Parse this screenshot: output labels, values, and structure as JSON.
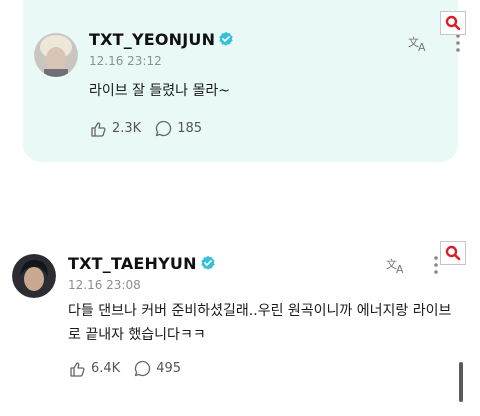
{
  "posts": [
    {
      "username": "TXT_YEONJUN",
      "timestamp": "12.16 23:12",
      "text": "라이브 잘 들렸나 몰라~",
      "likes": "2.3K",
      "comments": "185",
      "avatar_icon": "blond-avatar"
    },
    {
      "username": "TXT_TAEHYUN",
      "timestamp": "12.16 23:08",
      "text": "다들 댄브나 커버 준비하셨길래..우린 원곡이니까 에너지랑 라이브로 끝내자 했습니다ㅋㅋ",
      "likes": "6.4K",
      "comments": "495",
      "avatar_icon": "dark-hair-avatar"
    }
  ],
  "colors": {
    "card_bg": "#e9f9f6",
    "verified": "#35bfd9",
    "search_badge": "#d81f26",
    "muted": "#8a8f94"
  },
  "icons": [
    "verified-icon",
    "translate-icon",
    "more-icon",
    "like-icon",
    "comment-icon",
    "search-icon"
  ]
}
